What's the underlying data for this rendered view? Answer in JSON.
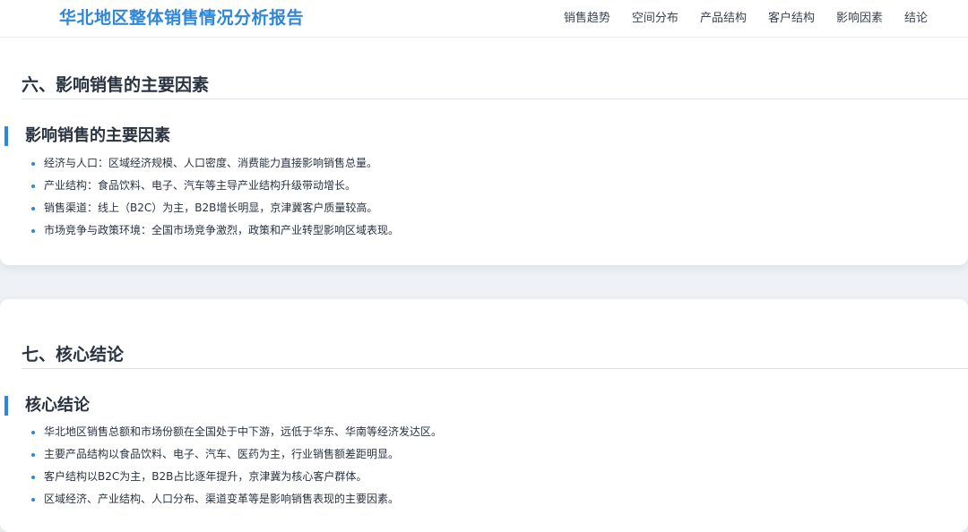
{
  "header": {
    "title": "华北地区整体销售情况分析报告",
    "nav": [
      "销售趋势",
      "空间分布",
      "产品结构",
      "客户结构",
      "影响因素",
      "结论"
    ]
  },
  "factors": {
    "section_title": "六、影响销售的主要因素",
    "sub_title": "影响销售的主要因素",
    "items": [
      "经济与人口：区域经济规模、人口密度、消费能力直接影响销售总量。",
      "产业结构：食品饮料、电子、汽车等主导产业结构升级带动增长。",
      "销售渠道：线上（B2C）为主，B2B增长明显，京津冀客户质量较高。",
      "市场竞争与政策环境：全国市场竞争激烈，政策和产业转型影响区域表现。"
    ]
  },
  "conclusion": {
    "section_title": "七、核心结论",
    "sub_title": "核心结论",
    "items": [
      "华北地区销售总额和市场份额在全国处于中下游，远低于华东、华南等经济发达区。",
      "主要产品结构以食品饮料、电子、汽车、医药为主，行业销售额差距明显。",
      "客户结构以B2C为主，B2B占比逐年提升，京津冀为核心客户群体。",
      "区域经济、产业结构、人口分布、渠道变革等是影响销售表现的主要因素。"
    ]
  }
}
